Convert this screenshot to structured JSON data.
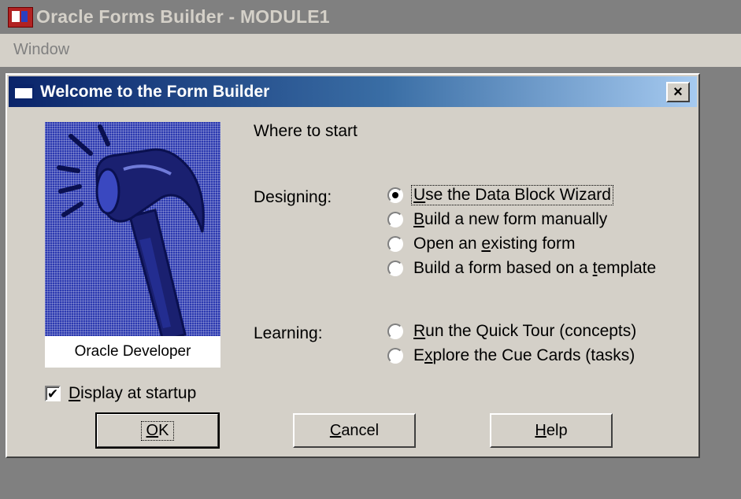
{
  "app": {
    "title": "Oracle Forms Builder - MODULE1",
    "icon": "forms-builder-icon"
  },
  "menu": {
    "items": [
      {
        "label": "Window"
      }
    ]
  },
  "dialog": {
    "title": "Welcome to the Form Builder",
    "close_label": "×",
    "image_caption": "Oracle Developer",
    "heading": "Where to start",
    "designing_label": "Designing:",
    "learning_label": "Learning:",
    "designing_options": [
      {
        "pre": "",
        "u": "U",
        "post": "se the Data Block Wizard",
        "checked": true
      },
      {
        "pre": "",
        "u": "B",
        "post": "uild a new form manually",
        "checked": false
      },
      {
        "pre": "Open an ",
        "u": "e",
        "post": "xisting form",
        "checked": false
      },
      {
        "pre": "Build a form based on a ",
        "u": "t",
        "post": "emplate",
        "checked": false
      }
    ],
    "learning_options": [
      {
        "pre": "",
        "u": "R",
        "post": "un the Quick Tour (concepts)",
        "checked": false
      },
      {
        "pre": "E",
        "u": "x",
        "post": "plore the Cue Cards (tasks)",
        "checked": false
      }
    ],
    "startup_checkbox": {
      "u": "D",
      "post": "isplay at startup",
      "checked": true,
      "check_mark": "✔"
    },
    "buttons": {
      "ok": {
        "u": "O",
        "post": "K"
      },
      "cancel": {
        "u": "C",
        "post": "ancel"
      },
      "help": {
        "u": "H",
        "post": "elp"
      }
    }
  },
  "colors": {
    "dialog_face": "#d4d0c8",
    "title_gradient_start": "#0a246a",
    "title_gradient_end": "#a6caf0",
    "image_blue": "#2c3ab0"
  }
}
